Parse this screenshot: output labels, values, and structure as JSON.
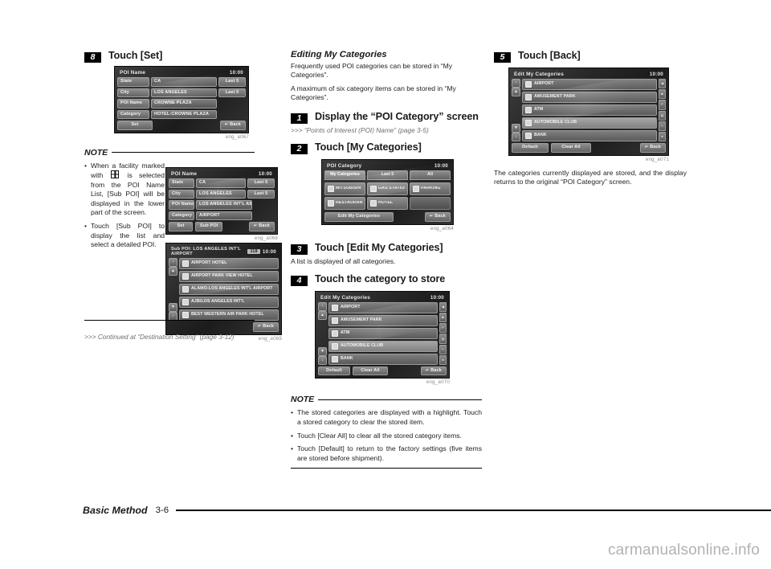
{
  "footer": {
    "section": "Basic Method",
    "page": "3-6",
    "watermark": "carmanualsonline.info"
  },
  "col1": {
    "step8": {
      "num": "8",
      "title": "Touch [Set]"
    },
    "shot_a067": {
      "caption": "eng_a067",
      "title": "POI Name",
      "clock": "10:00",
      "rows": [
        {
          "key": "State",
          "value": "CA",
          "side": "Last 5"
        },
        {
          "key": "City",
          "value": "LOS ANGELES",
          "side": "Last 5"
        },
        {
          "key": "POI Name",
          "value": "CROWNE PLAZA",
          "side": ""
        },
        {
          "key": "Category",
          "value": "HOTEL:CROWNE PLAZA",
          "side": ""
        }
      ],
      "buttons": [
        "Set"
      ],
      "back": "Back"
    },
    "note_label": "NOTE",
    "bullets": [
      {
        "pre": "When a facility marked with ",
        "icon": "grid-icon",
        "post": " is selected from the POI Name List, [Sub POI] will be displayed in the lower part of the screen."
      },
      {
        "pre": "Touch [Sub POI] to display the list and select a detailed POI.",
        "icon": "",
        "post": ""
      }
    ],
    "shot_a068": {
      "caption": "eng_a068",
      "title": "POI Name",
      "clock": "10:00",
      "rows": [
        {
          "key": "State",
          "value": "CA",
          "side": "Last 5"
        },
        {
          "key": "City",
          "value": "LOS ANGELES",
          "side": "Last 5"
        },
        {
          "key": "POI Name",
          "value": "LOS ANGELES INT'L AIRPORT",
          "side": ""
        },
        {
          "key": "Category",
          "value": "AIRPORT",
          "side": ""
        }
      ],
      "buttons": [
        "Set",
        "Sub POI"
      ],
      "back": "Back"
    },
    "shot_a069": {
      "caption": "eng_a069",
      "title": "Sub POI: LOS ANGELES INT'L AIRPORT",
      "count": "118",
      "clock": "10:00",
      "items": [
        "AIRPORT HOTEL",
        "AIRPORT PARK VIEW HOTEL",
        "ALAMO-LOS ANGELES INT'L AIRPORT",
        "AJB/LOS ANGELES INT'L",
        "BEST WESTERN AIR PARK HOTEL"
      ],
      "scroll": [
        "↑",
        "▲",
        "▼",
        "↓"
      ],
      "back": "Back"
    },
    "continued": ">>> Continued at “Destination Setting” (page 3-12)"
  },
  "col2": {
    "section_title": "Editing My Categories",
    "intro": [
      "Frequently used POI categories can be stored in “My Categories”.",
      "A maximum of six category items can be stored in “My Categories”."
    ],
    "step1": {
      "num": "1",
      "title": "Display the “POI Category” screen",
      "ref": ">>> “Points of Interest (POI) Name” (page 3-5)"
    },
    "step2": {
      "num": "2",
      "title": "Touch [My Categories]"
    },
    "shot_a064": {
      "caption": "eng_a064",
      "title": "POI Category",
      "clock": "10:00",
      "tabs": [
        "My Categories",
        "Last 5",
        "All"
      ],
      "selected_tab": "My Categories",
      "cells": [
        {
          "label": "MITSUBISHI MOTORS",
          "empty": false
        },
        {
          "label": "GAS STATION",
          "empty": false
        },
        {
          "label": "PARKING",
          "empty": false
        },
        {
          "label": "RESTAURANT",
          "empty": false
        },
        {
          "label": "HOTEL",
          "empty": false
        },
        {
          "label": "",
          "empty": true
        }
      ],
      "edit_button": "Edit My Categories",
      "back": "Back"
    },
    "step3": {
      "num": "3",
      "title": "Touch [Edit My Categories]",
      "desc": "A list is displayed of all categories."
    },
    "step4": {
      "num": "4",
      "title": "Touch the category to store"
    },
    "shot_a070": {
      "caption": "eng_a070",
      "title": "Edit My Categories",
      "clock": "10:00",
      "items": [
        {
          "label": "AIRPORT",
          "highlight": false
        },
        {
          "label": "AMUSEMENT PARK",
          "highlight": false
        },
        {
          "label": "ATM",
          "highlight": false
        },
        {
          "label": "AUTOMOBILE CLUB",
          "highlight": true
        },
        {
          "label": "BANK",
          "highlight": false
        }
      ],
      "scroll": [
        "↑",
        "▲",
        "▼",
        "↓"
      ],
      "alpha": [
        "◀",
        "■",
        "P",
        "▤",
        "↖",
        "●"
      ],
      "buttons": [
        "Default",
        "Clear All"
      ],
      "back": "Back"
    },
    "note_label": "NOTE",
    "bullets": [
      "The stored categories are displayed with a highlight. Touch a stored category to clear the stored item.",
      "Touch [Clear All] to clear all the stored category items.",
      "Touch [Default] to return to the factory settings (five items are stored before shipment)."
    ]
  },
  "col3": {
    "step5": {
      "num": "5",
      "title": "Touch [Back]"
    },
    "shot_a071": {
      "caption": "eng_a071",
      "title": "Edit My Categories",
      "clock": "10:00",
      "items": [
        {
          "label": "AIRPORT",
          "highlight": false
        },
        {
          "label": "AMUSEMENT PARK",
          "highlight": false
        },
        {
          "label": "ATM",
          "highlight": false
        },
        {
          "label": "AUTOMOBILE CLUB",
          "highlight": true
        },
        {
          "label": "BANK",
          "highlight": false
        }
      ],
      "scroll": [
        "↑",
        "▲",
        "▼",
        "↓"
      ],
      "alpha": [
        "◀",
        "■",
        "P",
        "▤",
        "↖",
        "●"
      ],
      "buttons": [
        "Default",
        "Clear All"
      ],
      "back": "Back"
    },
    "after_text": "The categories currently displayed are stored, and the display returns to the original “POI Category” screen."
  }
}
